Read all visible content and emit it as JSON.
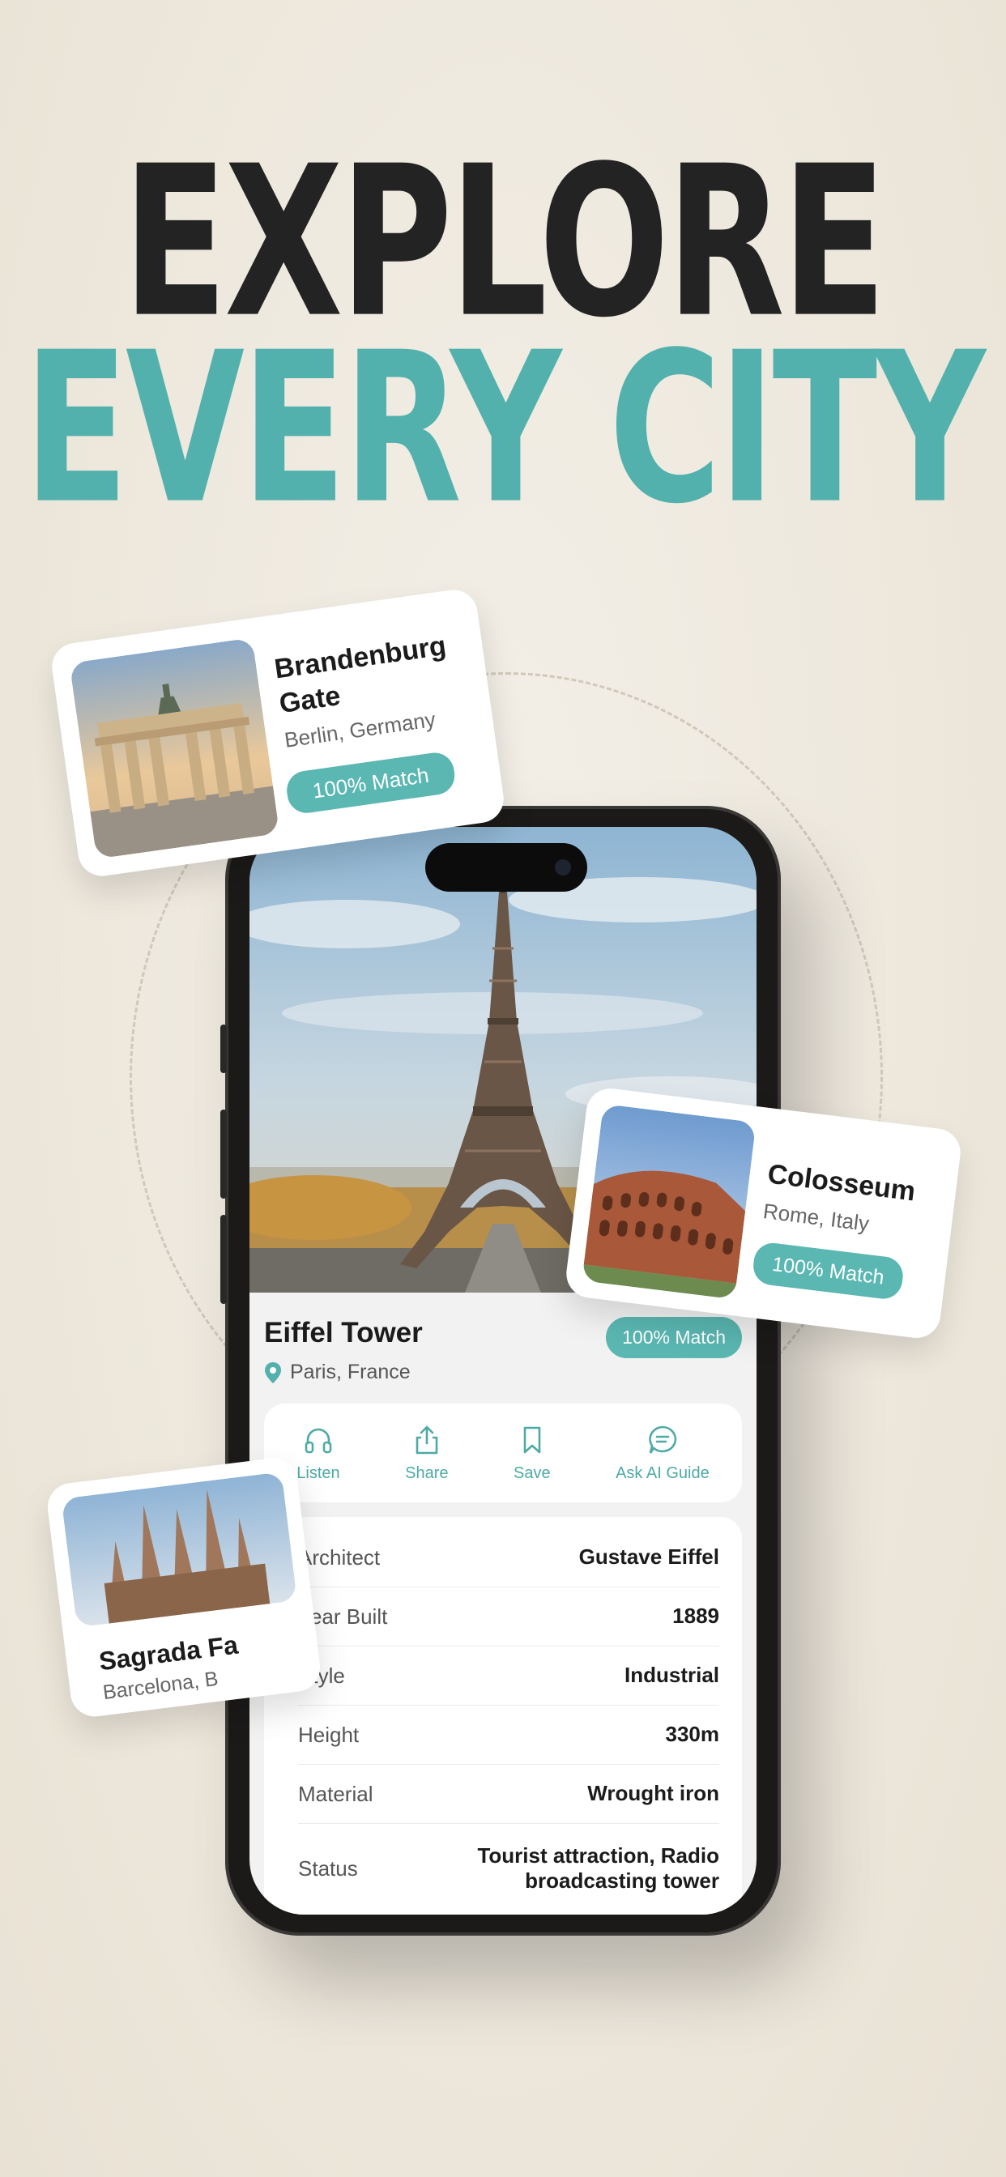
{
  "headline": {
    "line1": "EXPLORE",
    "line2": "EVERY CITY"
  },
  "colors": {
    "accent": "#52b1ad",
    "dark": "#232323",
    "background": "#eee8dd"
  },
  "app": {
    "place": {
      "name": "Eiffel Tower",
      "location": "Paris, France",
      "match": "100% Match"
    },
    "actions": [
      {
        "label": "Listen",
        "icon": "headphones-icon"
      },
      {
        "label": "Share",
        "icon": "share-icon"
      },
      {
        "label": "Save",
        "icon": "bookmark-icon"
      },
      {
        "label": "Ask AI Guide",
        "icon": "chat-icon"
      }
    ],
    "details": [
      {
        "label": "Architect",
        "value": "Gustave Eiffel"
      },
      {
        "label": "Year Built",
        "value": "1889"
      },
      {
        "label": "Style",
        "value": "Industrial"
      },
      {
        "label": "Height",
        "value": "330m"
      },
      {
        "label": "Material",
        "value": "Wrought iron"
      },
      {
        "label": "Status",
        "value": "Tourist attraction, Radio broadcasting tower"
      }
    ]
  },
  "cards": {
    "brandenburg": {
      "name": "Brandenburg Gate",
      "location": "Berlin, Germany",
      "match": "100% Match"
    },
    "colosseum": {
      "name": "Colosseum",
      "location": "Rome, Italy",
      "match": "100% Match"
    },
    "sagrada": {
      "name": "Sagrada Fa",
      "location": "Barcelona, B"
    }
  }
}
